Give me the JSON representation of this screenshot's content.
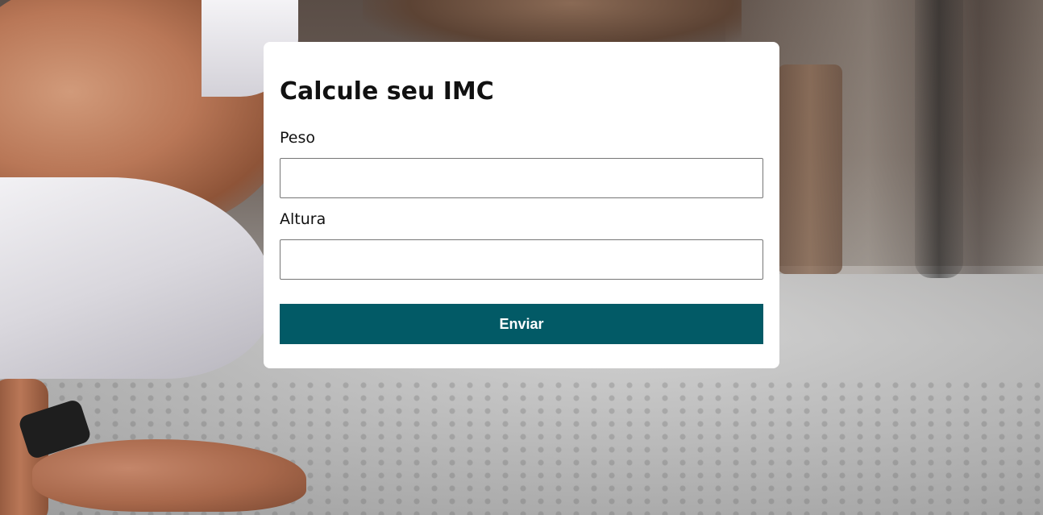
{
  "form": {
    "title": "Calcule seu IMC",
    "peso": {
      "label": "Peso",
      "value": "",
      "placeholder": ""
    },
    "altura": {
      "label": "Altura",
      "value": "",
      "placeholder": ""
    },
    "submit_label": "Enviar"
  },
  "colors": {
    "button_background": "#025a66",
    "button_text": "#ffffff",
    "card_background": "#ffffff"
  }
}
